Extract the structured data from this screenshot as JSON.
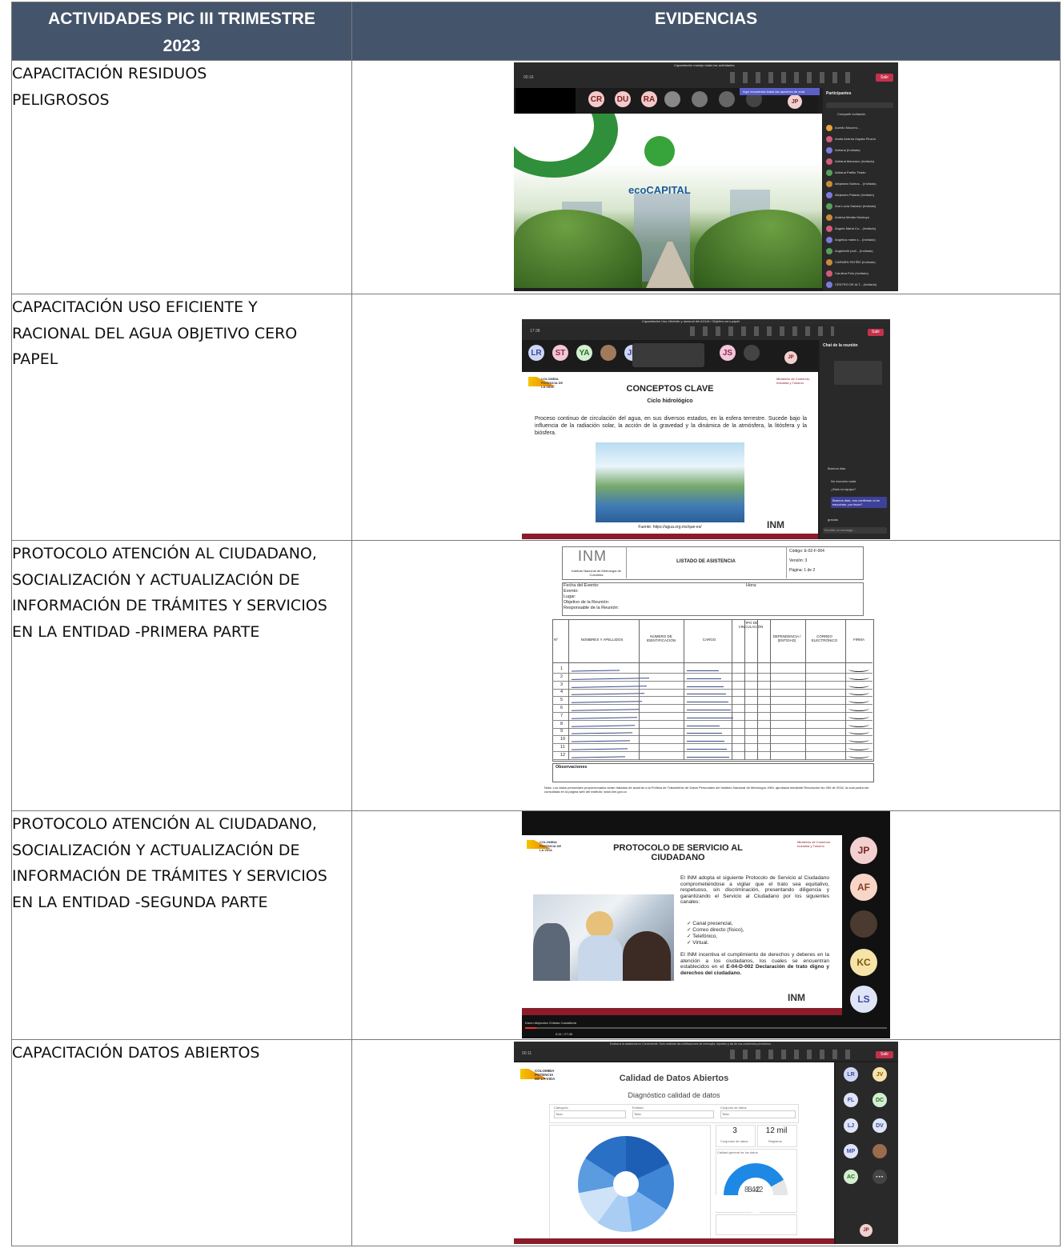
{
  "header": {
    "col1": "ACTIVIDADES PIC III TRIMESTRE 2023",
    "col2": "EVIDENCIAS"
  },
  "rows": [
    {
      "activity": "CAPACITACIÓN RESIDUOS PELIGROSOS",
      "evidence": {
        "window_title": "Capacitación manejo todas las actividades",
        "time": "00:16",
        "avatars": [
          "CR",
          "DU",
          "RA"
        ],
        "notice": "Aquí encontrará todas las opciones de chat",
        "panel_title": "Participantes",
        "invite": "Compartir invitación",
        "participants": [
          "Aurelio Mocorro...",
          "Andia Andrea Zapata Pinzón",
          "Adriana (Invitado)",
          "Adriana Manzano (Invitado)",
          "Adriana Patiño Tirado",
          "Alejandra Santos... (Invitado)",
          "Alejandro Palacio (Invitado)",
          "Ana Lucía Salcedo (Invitado)",
          "Andrea Medán Montoya",
          "Ángela María Co... (Invitado)",
          "Angelica maria s... (Invitado)",
          "Angiebeth (coil... (Invitado)",
          "CARMEN PATIÑO (Invitado)",
          "Carolina Polo (Invitado)",
          "CENTRO DE ALT... (Invitado)"
        ],
        "logo_text": "ecoCAPITAL",
        "leave": "Salir",
        "user_initials": "JP"
      }
    },
    {
      "activity": "CAPACITACIÓN USO EFICIENTE Y RACIONAL DEL AGUA  OBJETIVO CERO PAPEL",
      "evidence": {
        "window_title": "Capacitación Uso eficiente y racional del AGUA / Objetivo cero papel",
        "time": "17:38",
        "avatars": [
          "LR",
          "ST",
          "YA",
          "JR",
          "JS"
        ],
        "user_initials": "JP",
        "slide_title": "CONCEPTOS CLAVE",
        "slide_subtitle": "Ciclo hidrológico",
        "slide_body": "Proceso continuo de circulación del agua, en sus diversos estados, en la esfera terrestre. Sucede bajo la influencia de la radiación solar, la acción de la gravedad y la dinámica de la atmósfera, la litósfera y la biósfera.",
        "slide_source": "Fuente: https://agua.org.mx/que-es/",
        "ministry": "Ministerio de Comercio, Industria y Turismo",
        "brand": "COLOMBIA POTENCIA DE LA VIDA",
        "inm": "INM",
        "chat_title": "Chat de la reunión",
        "chat_messages": [
          "Buenos días",
          "No escucho nada",
          "¿Está mi equipo?",
          "Buenos días, nos confirman si se escuchan, por favor?",
          "Sí",
          "gracias"
        ],
        "chat_input": "Escribir un mensaje...",
        "leave": "Salir"
      }
    },
    {
      "activity": "PROTOCOLO ATENCIÓN AL CIUDADANO, SOCIALIZACIÓN Y ACTUALIZACIÓN DE INFORMACIÓN DE TRÁMITES Y SERVICIOS EN LA ENTIDAD  -PRIMERA PARTE",
      "evidence": {
        "doc_title": "LISTADO DE ASISTENCIA",
        "code": "Código: E-02-F-004",
        "version": "Versión: 3",
        "page": "Página: 1 de 2",
        "inm_caption": "Instituto Nacional de Metrología de Colombia",
        "fields": [
          "Fecha del Evento:",
          "Evento:",
          "Lugar:",
          "Objetivo de la Reunión:",
          "Responsable de la Reunión:"
        ],
        "hour": "Hora:",
        "columns": [
          "Nº",
          "NOMBRES Y APELLIDOS",
          "NÚMERO DE IDENTIFICACIÓN",
          "CARGO",
          "TIPO DE VINCULACIÓN",
          "DEPENDENCIA / (ENTIDAD)",
          "CORREO ELECTRÓNICO",
          "FIRMA"
        ],
        "row_numbers": [
          "1",
          "2",
          "3",
          "4",
          "5",
          "6",
          "7",
          "8",
          "9",
          "10",
          "11",
          "12"
        ],
        "observations": "Observaciones",
        "note": "Nota: Los datos personales proporcionados serán tratados de acuerdo a la Política de Tratamiento de Datos Personales del Instituto Nacional de Metrología -INM, aprobada mediante Resolución No 450 de 2016, la cual podrá ser consultada en la página web del instituto: www.inm.gov.co"
      }
    },
    {
      "activity": "PROTOCOLO ATENCIÓN AL CIUDADANO, SOCIALIZACIÓN Y ACTUALIZACIÓN DE INFORMACIÓN DE TRÁMITES Y SERVICIOS EN LA ENTIDAD  -SEGUNDA PARTE",
      "evidence": {
        "slide_title": "PROTOCOLO DE SERVICIO AL CIUDADANO",
        "slide_text": "El INM adopta el siguiente Protocolo de Servicio al Ciudadano comprometiéndose a vigilar que el trato sea equitativo, respetuoso, sin discriminación, presentando diligencia y garantizando el Servicio al Ciudadano por los siguientes canales:",
        "channels": [
          "Canal presencial,",
          "Correo directo (físico),",
          "Telefónico,",
          "Virtual."
        ],
        "slide_text2": "El INM incentiva el cumplimiento de derechos y deberes en la atención a los ciudadanos, los cuales se encuentran establecidos en el",
        "slide_bold": "E-04-D-002 Declaración de trato digno y derechos del ciudadano.",
        "brand": "COLOMBIA POTENCIA DE LA VIDA",
        "ministry": "Ministerio de Comercio, Industria y Turismo",
        "inm": "INM",
        "participants": [
          "JP",
          "AF",
          "KC",
          "LS"
        ],
        "presenter": "Karen Alejandra Chilatra Castañeda",
        "timer": "0:41 / 27:45"
      }
    },
    {
      "activity": "CAPACITACIÓN DATOS ABIERTOS",
      "evidence": {
        "banner": "Evalúa si la asistencia es Conveniente. Solo recibirás las notificaciones de mensajes, reportes y las de sus contenidos prioritarios.",
        "time": "00:11",
        "slide_title": "Calidad de Datos Abiertos",
        "slide_subtitle": "Diagnóstico calidad de datos",
        "filters": [
          "Categoría",
          "Entidad",
          "Conjunto de datos"
        ],
        "filter_values": [
          "Todo",
          "Todo",
          "Todo"
        ],
        "kpi1_value": "3",
        "kpi1_label": "Conjuntos de datos",
        "kpi2_value": "12 mil",
        "kpi2_label": "Registros",
        "gauge_title": "Calidad general de los datos",
        "gauge_value": "8.42",
        "brand": "COLOMBIA POTENCIA DE LA VIDA",
        "participants": [
          "LR",
          "JV",
          "FL",
          "DC",
          "LJ",
          "DV",
          "MP",
          "AC"
        ],
        "user_initials": "JP",
        "leave": "Salir"
      }
    }
  ]
}
